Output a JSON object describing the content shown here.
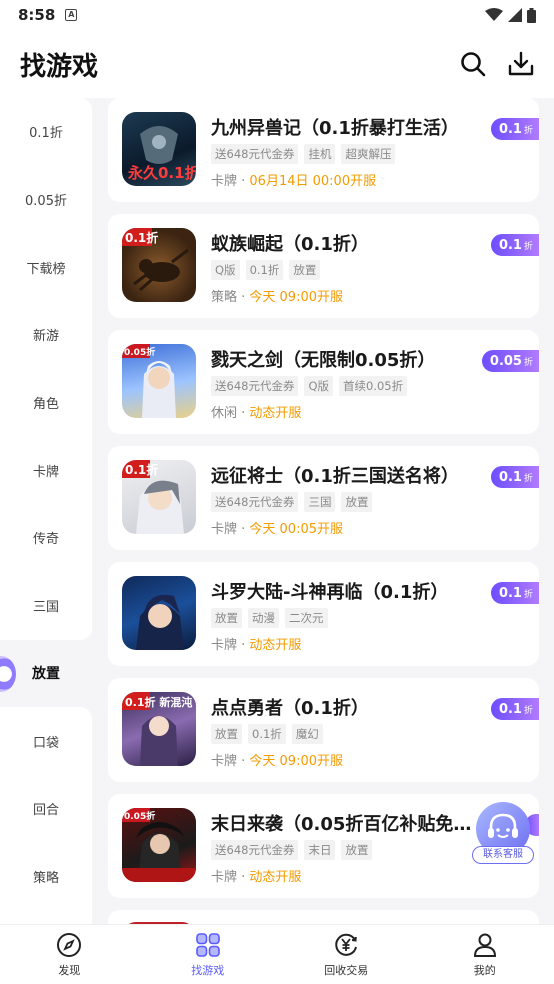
{
  "status": {
    "time": "8:58",
    "a_icon": "A"
  },
  "header": {
    "title": "找游戏"
  },
  "sidebar": {
    "items_top": [
      "0.1折",
      "0.05折",
      "下载榜",
      "新游",
      "角色",
      "卡牌",
      "传奇",
      "三国"
    ],
    "active": "放置",
    "items_bottom": [
      "口袋",
      "回合",
      "策略"
    ]
  },
  "games": [
    {
      "name": "九州异兽记（0.1折暴打生活）",
      "tags": [
        "送648元代金券",
        "挂机",
        "超爽解压"
      ],
      "category": "卡牌 · ",
      "time": "06月14日 00:00开服",
      "badge": "0.1",
      "badge_unit": "折"
    },
    {
      "name": "蚁族崛起（0.1折）",
      "tags": [
        "Q版",
        "0.1折",
        "放置"
      ],
      "category": "策略 · ",
      "time": "今天 09:00开服",
      "badge": "0.1",
      "badge_unit": "折"
    },
    {
      "name": "戮天之剑（无限制0.05折）",
      "tags": [
        "送648元代金券",
        "Q版",
        "首续0.05折"
      ],
      "category": "休闲 · ",
      "time": "动态开服",
      "badge": "0.05",
      "badge_unit": "折"
    },
    {
      "name": "远征将士（0.1折三国送名将）",
      "tags": [
        "送648元代金券",
        "三国",
        "放置"
      ],
      "category": "卡牌 · ",
      "time": "今天 00:05开服",
      "badge": "0.1",
      "badge_unit": "折"
    },
    {
      "name": "斗罗大陆-斗神再临（0.1折）",
      "tags": [
        "放置",
        "动漫",
        "二次元"
      ],
      "category": "卡牌 · ",
      "time": "动态开服",
      "badge": "0.1",
      "badge_unit": "折"
    },
    {
      "name": "点点勇者（0.1折）",
      "tags": [
        "放置",
        "0.1折",
        "魔幻"
      ],
      "category": "卡牌 · ",
      "time": "今天 09:00开服",
      "badge": "0.1",
      "badge_unit": "折"
    },
    {
      "name": "末日来袭（0.05折百亿补贴免...",
      "tags": [
        "送648元代金券",
        "末日",
        "放置"
      ],
      "category": "卡牌 · ",
      "time": "动态开服",
      "badge": "",
      "badge_unit": "折"
    }
  ],
  "thumb_text": [
    "永久0.1折",
    "0.1折",
    "0.05折",
    "0.1折",
    "",
    "0.1折 新混沌",
    "0.05折"
  ],
  "service": {
    "label": "联系客服"
  },
  "tabs": [
    {
      "label": "发现",
      "icon": "compass-icon"
    },
    {
      "label": "找游戏",
      "icon": "grid-icon"
    },
    {
      "label": "回收交易",
      "icon": "yen-icon"
    },
    {
      "label": "我的",
      "icon": "person-icon"
    }
  ],
  "colors": {
    "accent": "#5a5aff",
    "time": "#f29b00",
    "badge": "#7b55ff"
  }
}
